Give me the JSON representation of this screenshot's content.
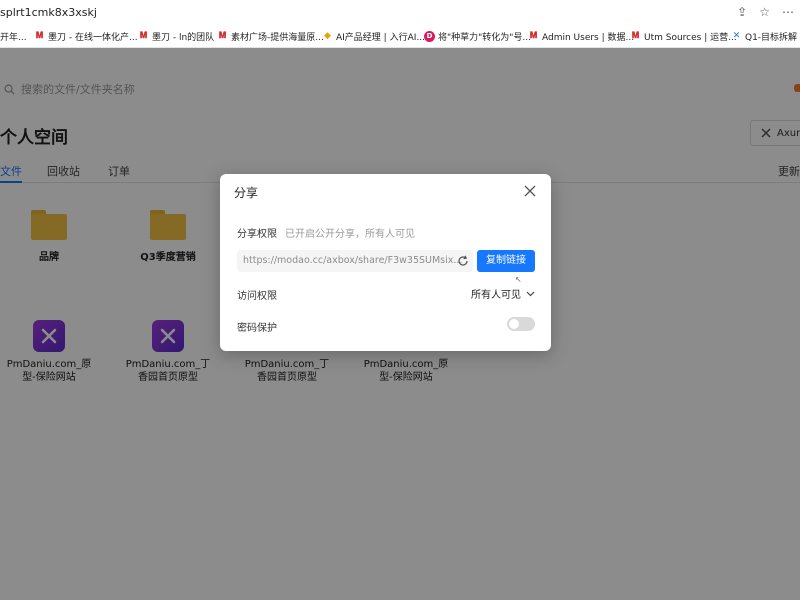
{
  "browser": {
    "url": "splrt1cmk8x3xskj",
    "bookmarks": [
      {
        "icon": "generic-icon",
        "label": "开年..."
      },
      {
        "icon": "modao-icon",
        "label": "墨刀 - 在线一体化产..."
      },
      {
        "icon": "modao-icon",
        "label": "墨刀 - ln的团队"
      },
      {
        "icon": "modao-icon",
        "label": "素材广场-提供海量原..."
      },
      {
        "icon": "multicolor-icon",
        "label": "AI产品经理 | 入行AI..."
      },
      {
        "icon": "circle-d-icon",
        "label": "将\"种草力\"转化为\"号..."
      },
      {
        "icon": "modao-icon",
        "label": "Admin Users | 数据..."
      },
      {
        "icon": "modao-icon",
        "label": "Utm Sources | 运营..."
      },
      {
        "icon": "x-logo-icon",
        "label": "Q1-目标拆解 -"
      }
    ]
  },
  "page": {
    "search_placeholder": "搜索的文件/文件夹名称",
    "title": "个人空间",
    "axure_label": "Axure",
    "tabs": [
      "文件",
      "回收站",
      "订单"
    ],
    "tab_right": "更新",
    "folders": [
      "品牌",
      "Q3季度营销"
    ],
    "prototypes": [
      {
        "line1": "PmDaniu.com_原",
        "line2": "型-保险网站"
      },
      {
        "line1": "PmDaniu.com_丁",
        "line2": "香园首页原型"
      },
      {
        "line1": "PmDaniu.com_丁",
        "line2": "香园首页原型"
      },
      {
        "line1": "PmDaniu.com_原",
        "line2": "型-保险网站"
      }
    ]
  },
  "dialog": {
    "title": "分享",
    "share_perm_label": "分享权限",
    "share_perm_hint": "已开启公开分享，所有人可见",
    "link": "https://modao.cc/axbox/share/F3w35SUMsix...",
    "copy_label": "复制链接",
    "access_label": "访问权限",
    "access_value": "所有人可见",
    "password_label": "密码保护",
    "password_enabled": false
  },
  "colors": {
    "accent": "#1677ff",
    "folder": "#f1c244",
    "overlay": "rgba(0,0,0,0.45)"
  }
}
